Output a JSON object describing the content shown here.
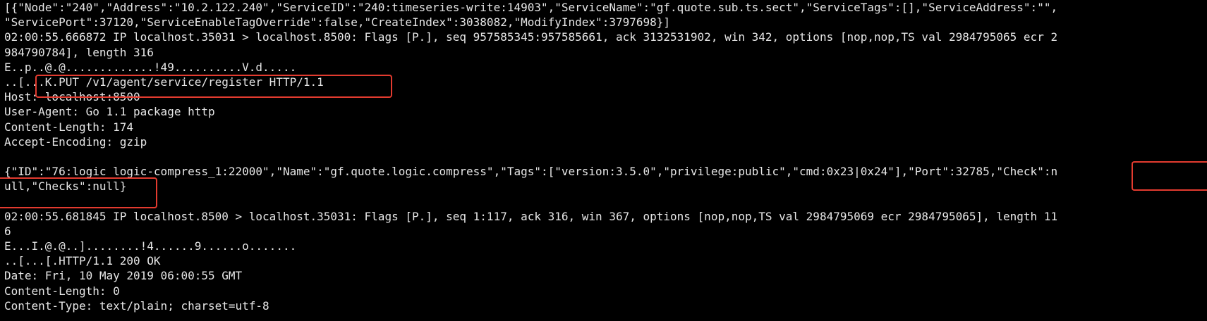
{
  "terminal": {
    "background": "#000000",
    "foreground": "#e6e6e6",
    "highlight_color": "#e33b2f",
    "lines": [
      "[{\"Node\":\"240\",\"Address\":\"10.2.122.240\",\"ServiceID\":\"240:timeseries-write:14903\",\"ServiceName\":\"gf.quote.sub.ts.sect\",\"ServiceTags\":[],\"ServiceAddress\":\"\",",
      "\"ServicePort\":37120,\"ServiceEnableTagOverride\":false,\"CreateIndex\":3038082,\"ModifyIndex\":3797698}]",
      "02:00:55.666872 IP localhost.35031 > localhost.8500: Flags [P.], seq 957585345:957585661, ack 3132531902, win 342, options [nop,nop,TS val 2984795065 ecr 2",
      "984790784], length 316",
      "E..p..@.@.............!49..........V.d.....",
      "..[...K.PUT /v1/agent/service/register HTTP/1.1",
      "Host: localhost:8500",
      "User-Agent: Go 1.1 package http",
      "Content-Length: 174",
      "Accept-Encoding: gzip",
      "",
      "{\"ID\":\"76:logic_logic-compress_1:22000\",\"Name\":\"gf.quote.logic.compress\",\"Tags\":[\"version:3.5.0\",\"privilege:public\",\"cmd:0x23|0x24\"],\"Port\":32785,\"Check\":n",
      "ull,\"Checks\":null}",
      "",
      "02:00:55.681845 IP localhost.8500 > localhost.35031: Flags [P.], seq 1:117, ack 316, win 367, options [nop,nop,TS val 2984795069 ecr 2984795065], length 11",
      "6",
      "E...I.@.@..]........!4......9......o.......",
      "..[...[.HTTP/1.1 200 OK",
      "Date: Fri, 10 May 2019 06:00:55 GMT",
      "Content-Length: 0",
      "Content-Type: text/plain; charset=utf-8"
    ]
  }
}
